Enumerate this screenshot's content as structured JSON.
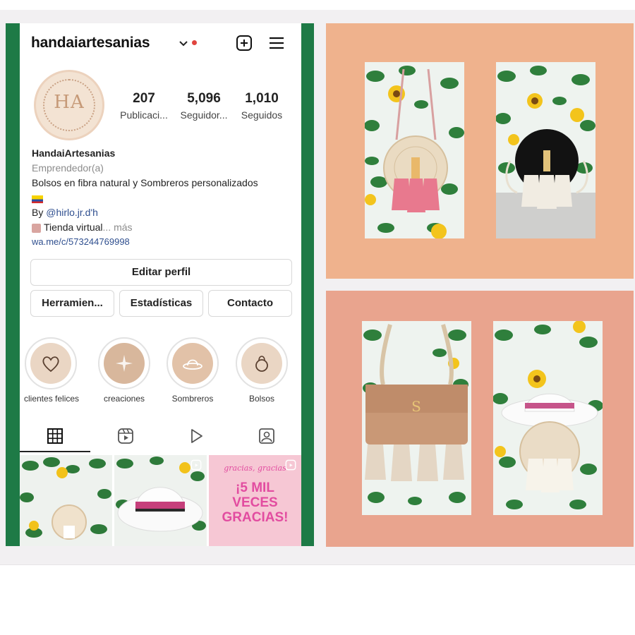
{
  "header": {
    "username": "handaiartesanias",
    "icons": [
      "chevron-down-icon",
      "notification-dot-icon",
      "add-post-icon",
      "menu-icon"
    ]
  },
  "profile": {
    "avatar_text": "HA",
    "stats": [
      {
        "value": "207",
        "label": "Publicaci..."
      },
      {
        "value": "5,096",
        "label": "Seguidor..."
      },
      {
        "value": "1,010",
        "label": "Seguidos"
      }
    ],
    "name": "HandaiArtesanias",
    "category": "Emprendedor(a)",
    "bio_line": "Bolsos en fibra natural y Sombreros personalizados",
    "by_prefix": "By ",
    "by_handle": "@hirlo.jr.d'h",
    "shop_line": "Tienda virtual",
    "more_label": "... más",
    "link": "wa.me/c/573244769998"
  },
  "buttons": {
    "edit_profile": "Editar perfil",
    "tools": "Herramien...",
    "statistics": "Estadísticas",
    "contact": "Contacto"
  },
  "highlights": [
    {
      "label": "clientes felices",
      "icon": "heart-icon"
    },
    {
      "label": "creaciones",
      "icon": "sparkle-icon"
    },
    {
      "label": "Sombreros",
      "icon": "hat-icon"
    },
    {
      "label": "Bolsos",
      "icon": "bag-icon"
    }
  ],
  "tabs": [
    "grid-icon",
    "reels-icon",
    "play-icon",
    "tagged-icon"
  ],
  "grid_posts": [
    {
      "kind": "bag-photo"
    },
    {
      "kind": "hat-photo",
      "icon": "reel-badge-icon"
    },
    {
      "kind": "thank-you-post",
      "top_text": "gracias, gracias",
      "title": "¡5 MIL VECES GRACIAS!",
      "icon": "reel-badge-icon"
    }
  ],
  "colors": {
    "phone_frame": "#1e7a46",
    "panel_top": "#efb28d",
    "panel_bottom": "#e9a48e",
    "accent_dot": "#e0443e",
    "thank_you_bg": "#f6c7d4",
    "thank_you_text": "#e24ca0"
  },
  "showcase": [
    {
      "item": "pink-tassel-round-bag"
    },
    {
      "item": "black-round-bag"
    },
    {
      "item": "tan-crochet-clutch"
    },
    {
      "item": "white-hat-bag"
    }
  ]
}
